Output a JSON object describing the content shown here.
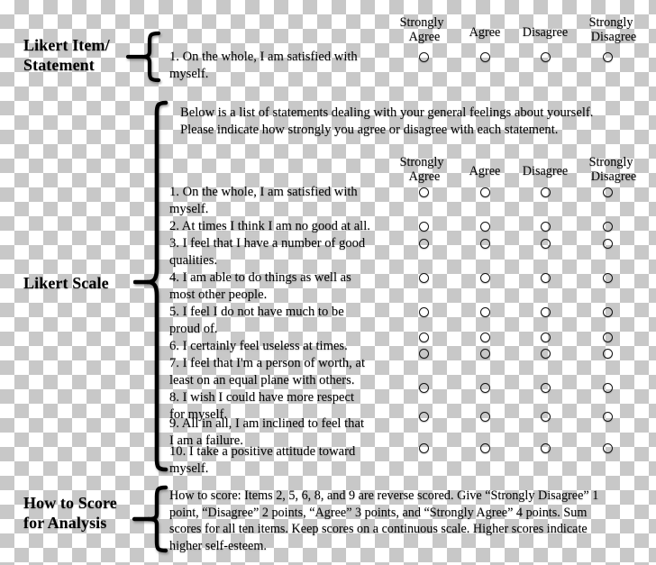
{
  "annotations": {
    "likert_item": "Likert Item/\nStatement",
    "likert_item_l1": "Likert Item/",
    "likert_item_l2": "Statement",
    "likert_scale": "Likert Scale",
    "how_to_score_l1": "How to Score",
    "how_to_score_l2": "for Analysis"
  },
  "scale_options": [
    {
      "line1": "Strongly",
      "line2": "Agree",
      "two_line": true
    },
    {
      "line1": "Agree",
      "line2": "",
      "two_line": false
    },
    {
      "line1": "Disagree",
      "line2": "",
      "two_line": false
    },
    {
      "line1": "Strongly",
      "line2": "Disagree",
      "two_line": true
    }
  ],
  "sample_item": {
    "line1": "1. On the whole, I am satisfied with",
    "line2": "myself."
  },
  "instructions": {
    "line1": "Below is a list of statements dealing with your general feelings about yourself.",
    "line2": "Please indicate how strongly you agree or disagree with each statement."
  },
  "statements": [
    {
      "line1": "1. On the whole, I am satisfied with",
      "line2": "myself."
    },
    {
      "line1": "2. At times I think I am no good at all.",
      "line2": ""
    },
    {
      "line1": "3. I feel that I have a number of good",
      "line2": "qualities."
    },
    {
      "line1": "4. I am able to do things as well as",
      "line2": "most other people."
    },
    {
      "line1": "5. I feel I do not have much to be",
      "line2": "proud of."
    },
    {
      "line1": "6. I certainly feel useless at times.",
      "line2": ""
    },
    {
      "line1": "7. I feel that I'm a person of worth, at",
      "line2": "least on an equal plane with others."
    },
    {
      "line1": "8. I wish I could have more respect",
      "line2": "for myself."
    },
    {
      "line1": "9. All in all, I am inclined to feel that",
      "line2": "I am a failure."
    },
    {
      "line1": "10. I take a positive attitude toward",
      "line2": "myself."
    }
  ],
  "scoring": {
    "line1": "How to score: Items 2, 5, 6, 8, and 9 are reverse scored. Give “Strongly Disagree” 1",
    "line2": "point, “Disagree” 2 points, “Agree” 3 points, and “Strongly Agree” 4 points. Sum",
    "line3": "scores for all ten items. Keep scores on a continuous scale. Higher scores indicate",
    "line4": "higher self-esteem."
  },
  "colors": {
    "ink": "#000000",
    "checker": "#c8c8c8",
    "paper": "#ffffff"
  }
}
